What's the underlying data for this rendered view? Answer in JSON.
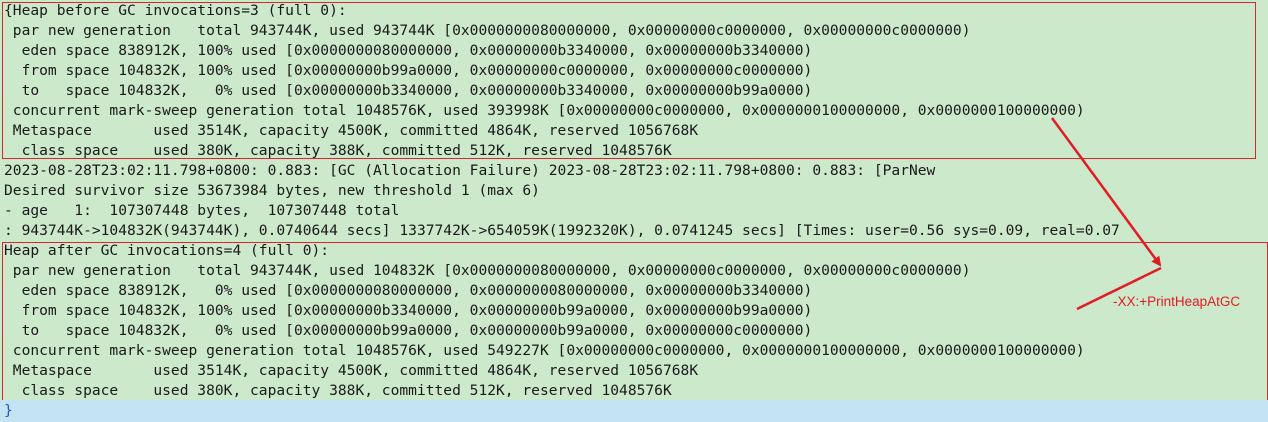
{
  "log_lines": [
    "{Heap before GC invocations=3 (full 0):",
    " par new generation   total 943744K, used 943744K [0x0000000080000000, 0x00000000c0000000, 0x00000000c0000000)",
    "  eden space 838912K, 100% used [0x0000000080000000, 0x00000000b3340000, 0x00000000b3340000)",
    "  from space 104832K, 100% used [0x00000000b99a0000, 0x00000000c0000000, 0x00000000c0000000)",
    "  to   space 104832K,   0% used [0x00000000b3340000, 0x00000000b3340000, 0x00000000b99a0000)",
    " concurrent mark-sweep generation total 1048576K, used 393998K [0x00000000c0000000, 0x0000000100000000, 0x0000000100000000)",
    " Metaspace       used 3514K, capacity 4500K, committed 4864K, reserved 1056768K",
    "  class space    used 380K, capacity 388K, committed 512K, reserved 1048576K",
    "2023-08-28T23:02:11.798+0800: 0.883: [GC (Allocation Failure) 2023-08-28T23:02:11.798+0800: 0.883: [ParNew",
    "Desired survivor size 53673984 bytes, new threshold 1 (max 6)",
    "- age   1:  107307448 bytes,  107307448 total",
    ": 943744K->104832K(943744K), 0.0740644 secs] 1337742K->654059K(1992320K), 0.0741245 secs] [Times: user=0.56 sys=0.09, real=0.07",
    "Heap after GC invocations=4 (full 0):",
    " par new generation   total 943744K, used 104832K [0x0000000080000000, 0x00000000c0000000, 0x00000000c0000000)",
    "  eden space 838912K,   0% used [0x0000000080000000, 0x0000000080000000, 0x00000000b3340000)",
    "  from space 104832K, 100% used [0x00000000b3340000, 0x00000000b99a0000, 0x00000000b99a0000)",
    "  to   space 104832K,   0% used [0x00000000b99a0000, 0x00000000b99a0000, 0x00000000c0000000)",
    " concurrent mark-sweep generation total 1048576K, used 549227K [0x00000000c0000000, 0x0000000100000000, 0x0000000100000000)",
    " Metaspace       used 3514K, capacity 4500K, committed 4864K, reserved 1056768K",
    "  class space    used 380K, capacity 388K, committed 512K, reserved 1048576K"
  ],
  "closing_brace": "}",
  "annotation": {
    "label": "-XX:+PrintHeapAtGC",
    "color": "#e21c24"
  },
  "colors": {
    "log_background": "#cde9cb",
    "highlight_border": "#e0242b",
    "selected_line_background": "#c4e4f4",
    "brace_color": "#2a52be"
  }
}
